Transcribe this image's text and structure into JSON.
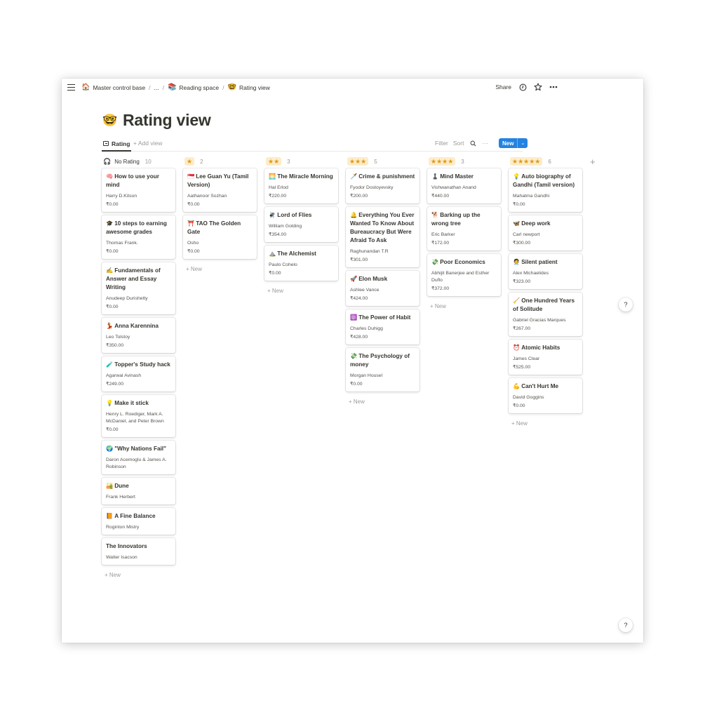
{
  "breadcrumb": [
    {
      "icon": "🏠",
      "label": "Master control base"
    },
    {
      "icon": "",
      "label": "..."
    },
    {
      "icon": "📚",
      "label": "Reading space"
    },
    {
      "icon": "🤓",
      "label": "Rating view"
    }
  ],
  "topbar": {
    "share_label": "Share"
  },
  "page": {
    "icon": "🤓",
    "title": "Rating view"
  },
  "views": {
    "active_tab": "Rating",
    "add_view": "+ Add view"
  },
  "toolbar": {
    "filter": "Filter",
    "sort": "Sort",
    "more": "···",
    "new_label": "New",
    "new_caret": "⌄"
  },
  "new_row_label": "+ New",
  "help_label": "?",
  "columns": [
    {
      "label": "No Rating",
      "stars": "",
      "count": "10",
      "cards": [
        {
          "icon": "🧠",
          "title": "How to use your mind",
          "author": "Harry D.Kitson",
          "price": "₹0.00"
        },
        {
          "icon": "🎓",
          "title": "10 steps to earning awesome grades",
          "author": "Thomas Frank.",
          "price": "₹0.00"
        },
        {
          "icon": "✍️",
          "title": "Fundamentals of Answer and Essay Writing",
          "author": "Anudeep Durishetty",
          "price": "₹0.00"
        },
        {
          "icon": "💃",
          "title": "Anna Karennina",
          "author": "Leo Tolstoy",
          "price": "₹350.00"
        },
        {
          "icon": "🧪",
          "title": "Topper's Study hack",
          "author": "Agarwal Avinash",
          "price": "₹249.00"
        },
        {
          "icon": "💡",
          "title": "Make it stick",
          "author": "Henry L. Roediger, Mark A. McDaniel, and Peter Brown",
          "price": "₹0.00"
        },
        {
          "icon": "🌍",
          "title": "\"Why Nations Fail\"",
          "author": "Daron Acemoglu & James A. Robinson",
          "price": ""
        },
        {
          "icon": "🏜️",
          "title": "Dune",
          "author": "Frank Herbert",
          "price": ""
        },
        {
          "icon": "📙",
          "title": "A Fine Balance",
          "author": "Roginton Mistry",
          "price": ""
        },
        {
          "icon": "",
          "title": "The Innovators",
          "author": "Walter Isacson",
          "price": ""
        }
      ]
    },
    {
      "label": "",
      "stars": "★",
      "count": "2",
      "cards": [
        {
          "icon": "🇸🇬",
          "title": "Lee Guan Yu (Tamil Version)",
          "author": "Aathanoor Sozhan",
          "price": "₹0.00"
        },
        {
          "icon": "⛩️",
          "title": "TAO The Golden Gate",
          "author": "Osho",
          "price": "₹0.00"
        }
      ]
    },
    {
      "label": "",
      "stars": "★★",
      "count": "3",
      "cards": [
        {
          "icon": "🌅",
          "title": "The Miracle Morning",
          "author": "Hal Erlod",
          "price": "₹220.00"
        },
        {
          "icon": "🪰",
          "title": "Lord of Flies",
          "author": "William Golding",
          "price": "₹354.00"
        },
        {
          "icon": "⛰️",
          "title": "The Alchemist",
          "author": "Paulo Cohelo",
          "price": "₹0.00"
        }
      ]
    },
    {
      "label": "",
      "stars": "★★★",
      "count": "5",
      "cards": [
        {
          "icon": "🗡️",
          "title": "Crime & punishment",
          "author": "Fyodor Dostoyevsky",
          "price": "₹200.00"
        },
        {
          "icon": "🔔",
          "title": "Everything You Ever Wanted To Know About Bureaucracy But Were Afraid To Ask",
          "author": "Raghunandan T.R",
          "price": "₹301.00"
        },
        {
          "icon": "🚀",
          "title": "Elon Musk",
          "author": "Ashlee Vance",
          "price": "₹424.00"
        },
        {
          "icon": "☸️",
          "title": "The Power of Habit",
          "author": "Charles Duhigg",
          "price": "₹428.00"
        },
        {
          "icon": "💸",
          "title": "The Psychology of money",
          "author": "Morgan Housel",
          "price": "₹0.00"
        }
      ]
    },
    {
      "label": "",
      "stars": "★★★★",
      "count": "3",
      "cards": [
        {
          "icon": "♟️",
          "title": "Mind Master",
          "author": "Vishwanathan Anand",
          "price": "₹440.00"
        },
        {
          "icon": "🐕",
          "title": "Barking up the wrong tree",
          "author": "Eric Barker",
          "price": "₹172.00"
        },
        {
          "icon": "💸",
          "title": "Poor Economics",
          "author": "Abhijit Banerjee and Esther Duflo",
          "price": "₹372.00"
        }
      ]
    },
    {
      "label": "",
      "stars": "★★★★★",
      "count": "6",
      "cards": [
        {
          "icon": "💡",
          "title": "Auto biography of Gandhi (Tamil version)",
          "author": "Mahatma Gandhi",
          "price": "₹0.00"
        },
        {
          "icon": "🦋",
          "title": "Deep work",
          "author": "Carl newport",
          "price": "₹300.00"
        },
        {
          "icon": "🧑‍⚕️",
          "title": "Silent patient",
          "author": "Alex Michaelides",
          "price": "₹323.00"
        },
        {
          "icon": "🧹",
          "title": "One Hundred Years of Solitude",
          "author": "Gabriel Gracias Marques",
          "price": "₹267.00"
        },
        {
          "icon": "⏰",
          "title": "Atomic Habits",
          "author": "James Clear",
          "price": "₹525.00"
        },
        {
          "icon": "💪",
          "title": "Can't Hurt Me",
          "author": "David Goggins",
          "price": "₹0.00"
        }
      ]
    }
  ]
}
